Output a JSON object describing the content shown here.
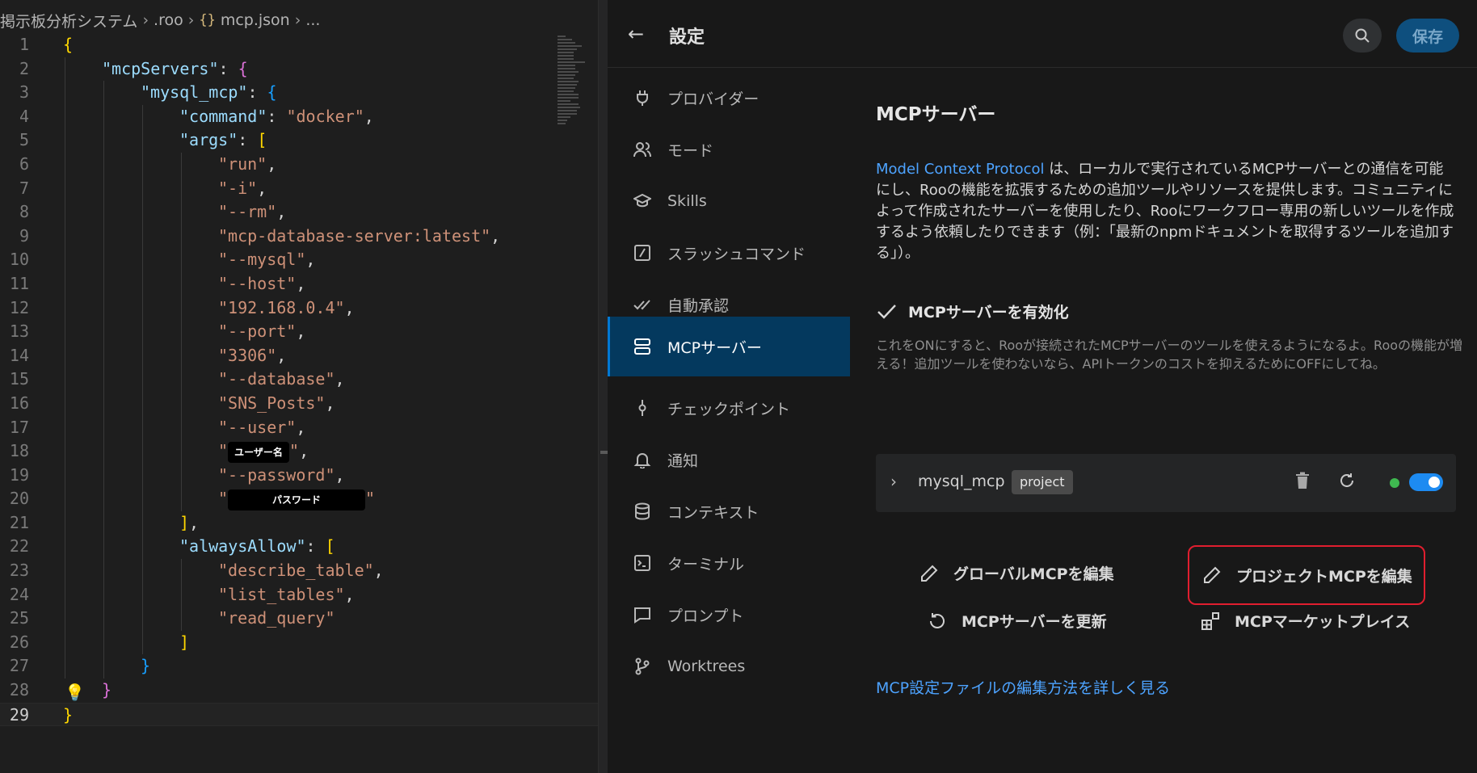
{
  "breadcrumb": [
    "掲示板分析システム",
    ".roo",
    "mcp.json",
    "..."
  ],
  "editor": {
    "lines": [
      {
        "n": "1"
      },
      {
        "n": "2"
      },
      {
        "n": "3"
      },
      {
        "n": "4"
      },
      {
        "n": "5"
      },
      {
        "n": "6"
      },
      {
        "n": "7"
      },
      {
        "n": "8"
      },
      {
        "n": "9"
      },
      {
        "n": "10"
      },
      {
        "n": "11"
      },
      {
        "n": "12"
      },
      {
        "n": "13"
      },
      {
        "n": "14"
      },
      {
        "n": "15"
      },
      {
        "n": "16"
      },
      {
        "n": "17"
      },
      {
        "n": "18"
      },
      {
        "n": "19"
      },
      {
        "n": "20"
      },
      {
        "n": "21"
      },
      {
        "n": "22"
      },
      {
        "n": "23"
      },
      {
        "n": "24"
      },
      {
        "n": "25"
      },
      {
        "n": "26"
      },
      {
        "n": "27"
      },
      {
        "n": "28"
      },
      {
        "n": "29"
      }
    ],
    "keys": {
      "mcpServers": "\"mcpServers\"",
      "mysql_mcp": "\"mysql_mcp\"",
      "command": "\"command\"",
      "args": "\"args\"",
      "alwaysAllow": "\"alwaysAllow\""
    },
    "values": {
      "command": "\"docker\"",
      "args": [
        "\"run\"",
        "\"-i\"",
        "\"--rm\"",
        "\"mcp-database-server:latest\"",
        "\"--mysql\"",
        "\"--host\"",
        "\"192.168.0.4\"",
        "\"--port\"",
        "\"3306\"",
        "\"--database\"",
        "\"SNS_Posts\"",
        "\"--user\"",
        "\"--password\""
      ],
      "always_allow": [
        "\"describe_table\"",
        "\"list_tables\"",
        "\"read_query\""
      ]
    },
    "redacted_user": "ユーザー名",
    "redacted_password": "パスワード",
    "current_line": 29
  },
  "settings": {
    "title": "設定",
    "save_label": "保存",
    "nav": [
      {
        "label": "プロバイダー",
        "icon": "plug-icon"
      },
      {
        "label": "モード",
        "icon": "users-icon"
      },
      {
        "label": "Skills",
        "icon": "graduation-cap-icon"
      },
      {
        "label": "スラッシュコマンド",
        "icon": "slash-square-icon"
      },
      {
        "label": "自動承認",
        "icon": "double-check-icon"
      },
      {
        "label": "MCPサーバー",
        "icon": "server-icon",
        "active": true
      },
      {
        "label": "チェックポイント",
        "icon": "git-commit-icon"
      },
      {
        "label": "通知",
        "icon": "bell-icon"
      },
      {
        "label": "コンテキスト",
        "icon": "database-icon"
      },
      {
        "label": "ターミナル",
        "icon": "terminal-icon"
      },
      {
        "label": "プロンプト",
        "icon": "message-icon"
      },
      {
        "label": "Worktrees",
        "icon": "git-branch-icon"
      }
    ],
    "section_title": "MCPサーバー",
    "desc_link": "Model Context Protocol",
    "desc_text": " は、ローカルで実行されているMCPサーバーとの通信を可能にし、Rooの機能を拡張するための追加ツールやリソースを提供します。コミュニティによって作成されたサーバーを使用したり、Rooにワークフロー専用の新しいツールを作成するよう依頼したりできます（例：「最新のnpmドキュメントを取得するツールを追加する」）。",
    "enable_label": "MCPサーバーを有効化",
    "enable_checked": true,
    "hint": "これをONにすると、Rooが接続されたMCPサーバーのツールを使えるようになるよ。Rooの機能が増える！追加ツールを使わないなら、APIトークンのコストを抑えるためにOFFにしてね。",
    "server": {
      "name": "mysql_mcp",
      "badge": "project",
      "enabled": true,
      "status_color": "#3fb950"
    },
    "actions": {
      "edit_global": "グローバルMCPを編集",
      "edit_project": "プロジェクトMCPを編集",
      "refresh": "MCPサーバーを更新",
      "marketplace": "MCPマーケットプレイス"
    },
    "learn_more": "MCP設定ファイルの編集方法を詳しく見る"
  },
  "colors": {
    "accent": "#0078d4",
    "link": "#4da3ff",
    "highlight_border": "#e01e2f",
    "active_nav": "#04395e"
  }
}
